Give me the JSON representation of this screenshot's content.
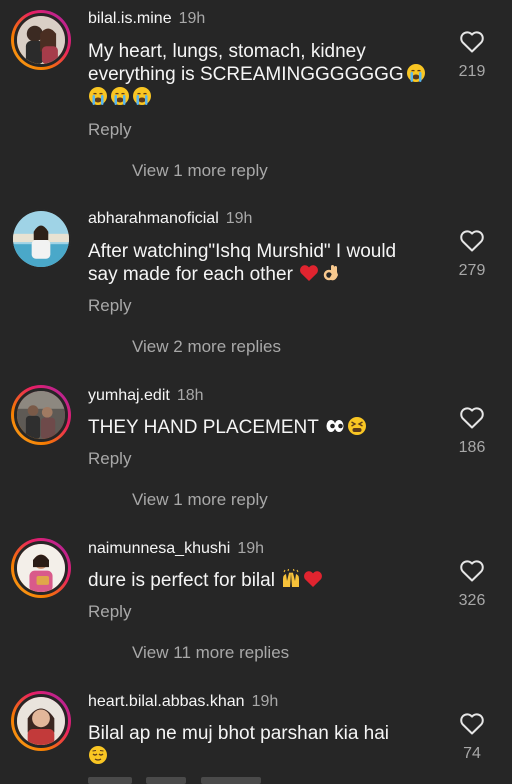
{
  "comments": [
    {
      "username": "bilal.is.mine",
      "time": "19h",
      "text_line1": "My heart, lungs, stomach, kidney",
      "text_line2": "everything is SCREAMINGGGGGGG",
      "emoji": [
        "loudly-crying-face",
        "loudly-crying-face",
        "loudly-crying-face",
        "loudly-crying-face"
      ],
      "reply_label": "Reply",
      "likes": "219",
      "view_more": "View 1 more reply"
    },
    {
      "username": "abharahmanoficial",
      "time": "19h",
      "text_line1": "After watching\"Ishq Murshid\" I would",
      "text_line2": "say made for each other",
      "emoji": [
        "red-heart",
        "ok-hand"
      ],
      "reply_label": "Reply",
      "likes": "279",
      "view_more": "View 2 more replies"
    },
    {
      "username": "yumhaj.edit",
      "time": "18h",
      "text_line1": "THEY HAND PLACEMENT",
      "emoji": [
        "eyes",
        "tired-face"
      ],
      "reply_label": "Reply",
      "likes": "186",
      "view_more": "View 1 more reply"
    },
    {
      "username": "naimunnesa_khushi",
      "time": "19h",
      "text_line1": "dure is perfect for bilal",
      "emoji": [
        "raising-hands",
        "red-heart"
      ],
      "reply_label": "Reply",
      "likes": "326",
      "view_more": "View 11 more replies"
    },
    {
      "username": "heart.bilal.abbas.khan",
      "time": "19h",
      "text_line1": "Bilal ap ne muj bhot parshan kia hai",
      "emoji": [
        "relieved-face"
      ],
      "likes": "74"
    }
  ],
  "icons": {
    "like": "heart-outline-icon"
  },
  "colors": {
    "background": "#262626",
    "primary_text": "#f5f5f5",
    "secondary_text": "#a8a8a8",
    "story_ring": [
      "#f9a825",
      "#e91e63",
      "#9c27b0"
    ]
  }
}
